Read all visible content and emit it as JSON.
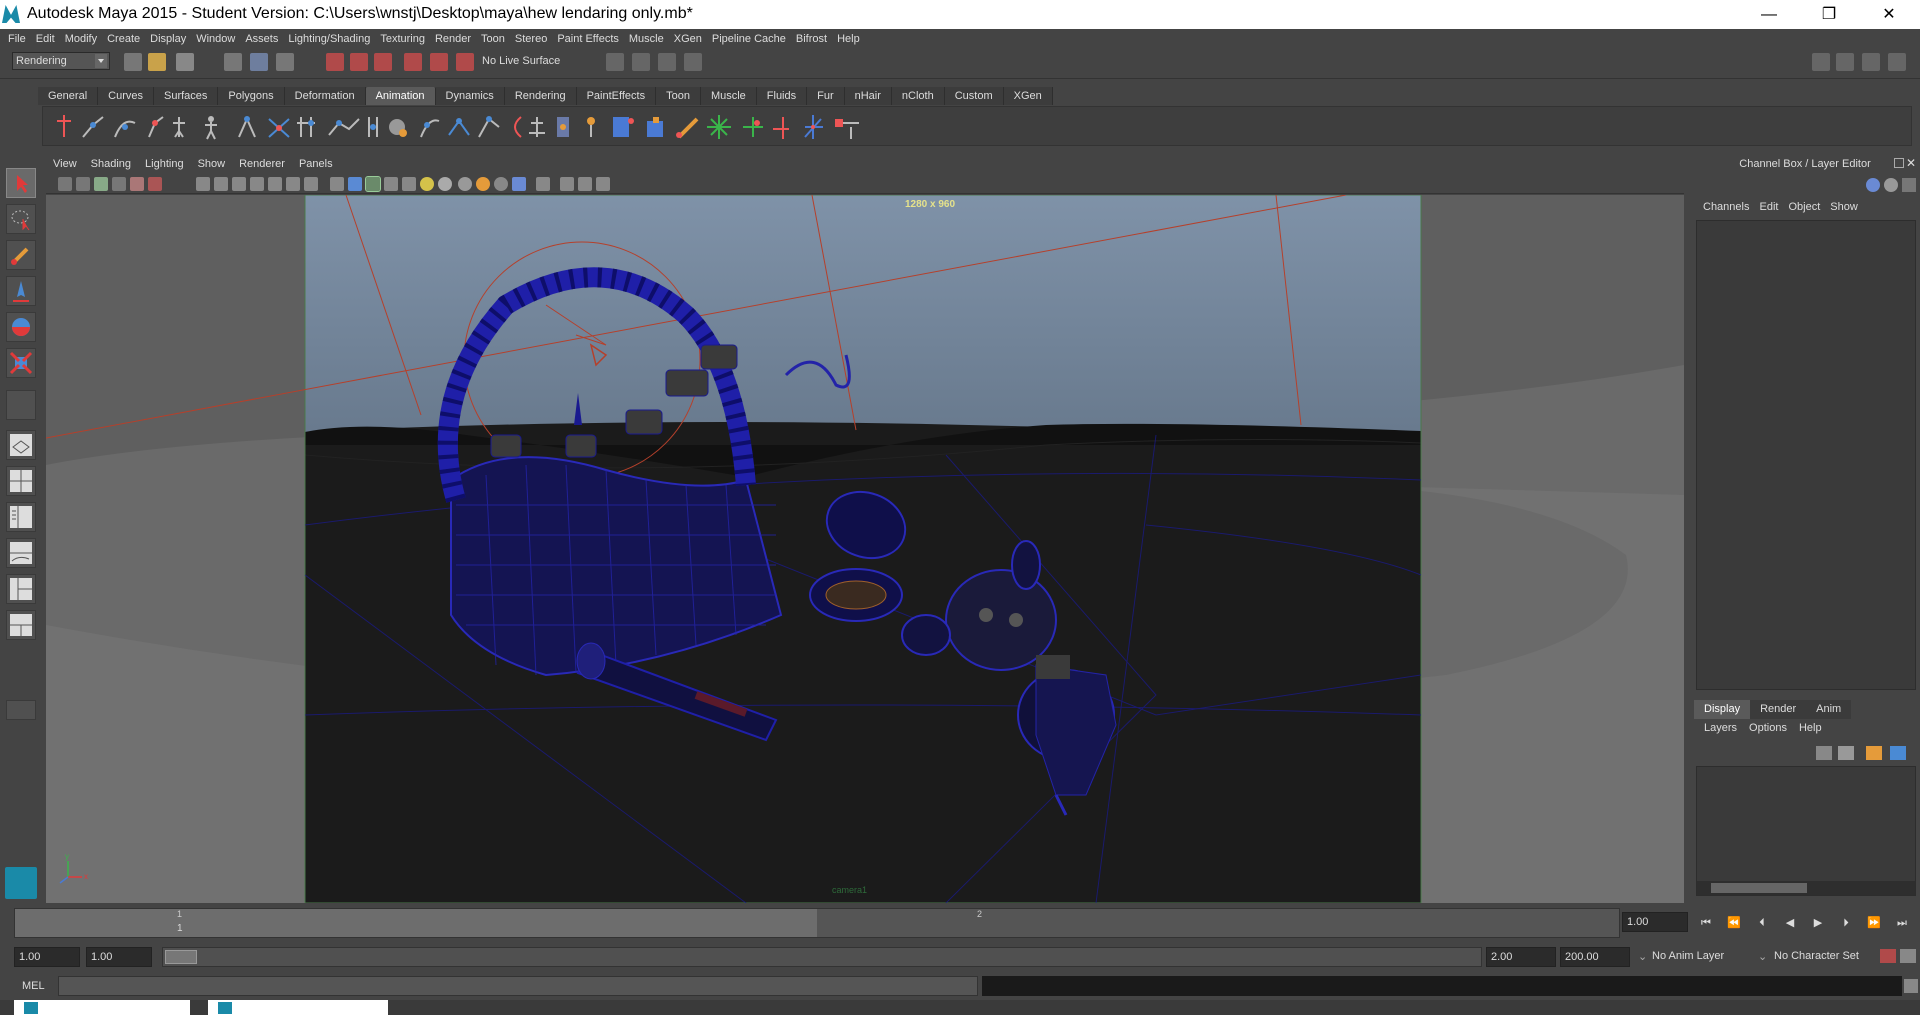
{
  "window": {
    "title": "Autodesk Maya 2015 - Student Version: C:\\Users\\wnstj\\Desktop\\maya\\hew lendaring only.mb*",
    "minimize": "—",
    "restore": "❐",
    "close": "✕"
  },
  "menubar": [
    "File",
    "Edit",
    "Modify",
    "Create",
    "Display",
    "Window",
    "Assets",
    "Lighting/Shading",
    "Texturing",
    "Render",
    "Toon",
    "Stereo",
    "Paint Effects",
    "Muscle",
    "XGen",
    "Pipeline Cache",
    "Bifrost",
    "Help"
  ],
  "statusline": {
    "menuset": "Rendering",
    "live_surface": "No Live Surface"
  },
  "shelf": {
    "tabs": [
      "General",
      "Curves",
      "Surfaces",
      "Polygons",
      "Deformation",
      "Animation",
      "Dynamics",
      "Rendering",
      "PaintEffects",
      "Toon",
      "Muscle",
      "Fluids",
      "Fur",
      "nHair",
      "nCloth",
      "Custom",
      "XGen"
    ],
    "active_tab": "Animation"
  },
  "panel": {
    "menu": [
      "View",
      "Shading",
      "Lighting",
      "Show",
      "Renderer",
      "Panels"
    ],
    "resolution_gate": "1280 x 960",
    "camera_name": "camera1"
  },
  "channelbox": {
    "title": "Channel Box / Layer Editor",
    "menu": [
      "Channels",
      "Edit",
      "Object",
      "Show"
    ],
    "layer_tabs": [
      "Display",
      "Render",
      "Anim"
    ],
    "layer_active": "Display",
    "layer_menu": [
      "Layers",
      "Options",
      "Help"
    ]
  },
  "timeline": {
    "tick_1": "1",
    "tick_1b": "1",
    "tick_2": "2",
    "current_frame": "1.00"
  },
  "range": {
    "start": "1.00",
    "playback_start": "1.00",
    "playback_end": "2.00",
    "end": "200.00",
    "anim_layer": "No Anim Layer",
    "character_set": "No Character Set"
  },
  "cmdline": {
    "label": "MEL"
  },
  "colors": {
    "wireframe": "#1a1a8f",
    "camera_lines": "#b5402b",
    "resolution_text": "#e5e28b",
    "background": "#444444"
  }
}
